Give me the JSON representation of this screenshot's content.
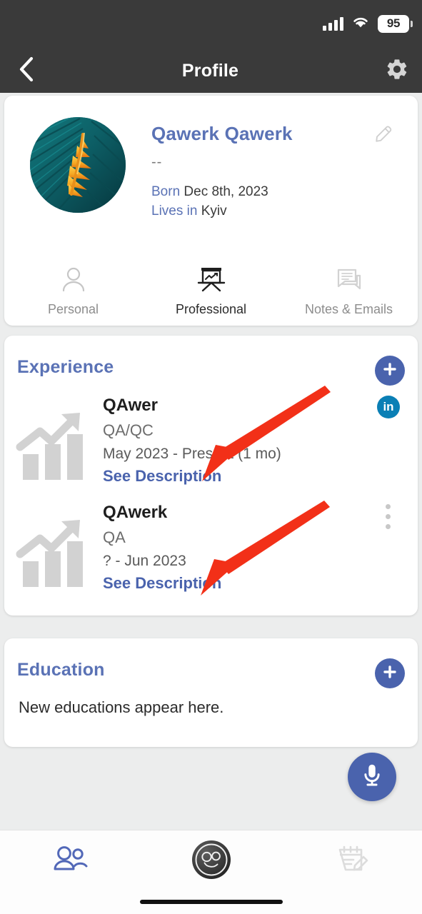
{
  "status_bar": {
    "signal_icon": "cellular-signal-icon",
    "wifi_icon": "wifi-icon",
    "battery_level": "95"
  },
  "header": {
    "back_icon": "chevron-left-icon",
    "title": "Profile",
    "settings_icon": "gear-icon",
    "background_color": "#3a3a3a"
  },
  "profile": {
    "avatar_icon": "avatar-photo",
    "name": "Qawerk Qawerk",
    "edit_icon": "pencil-icon",
    "subtitle": "--",
    "born_label": "Born",
    "born_value": "Dec 8th, 2023",
    "lives_label": "Lives in",
    "lives_value": "Kyiv",
    "name_color": "#5a72b5"
  },
  "tabs": [
    {
      "label": "Personal",
      "icon": "person-icon",
      "active": false
    },
    {
      "label": "Professional",
      "icon": "presentation-board-icon",
      "active": true
    },
    {
      "label": "Notes & Emails",
      "icon": "chat-bubbles-icon",
      "active": false
    }
  ],
  "experience": {
    "title": "Experience",
    "add_icon": "plus-icon",
    "add_color": "#4a63ad",
    "items": [
      {
        "icon": "growth-bar-chart-icon",
        "company": "QAwer",
        "role": "QA/QC",
        "dates": "May 2023 - Present (1 mo)",
        "description_link": "See Description",
        "badge": "linkedin-icon",
        "badge_label": "in",
        "badge_color": "#0a7fb5"
      },
      {
        "icon": "growth-bar-chart-icon",
        "company": "QAwerk",
        "role": "QA",
        "dates": "? - Jun 2023",
        "description_link": "See Description",
        "badge": "more-vertical-icon"
      }
    ]
  },
  "education": {
    "title": "Education",
    "add_icon": "plus-icon",
    "empty_text": "New educations appear here."
  },
  "mic_fab": {
    "icon": "microphone-icon",
    "color": "#4a63ad"
  },
  "bottom_nav": [
    {
      "icon": "contacts-people-icon",
      "active": true
    },
    {
      "icon": "app-logo-icon",
      "active": false
    },
    {
      "icon": "calendar-edit-icon",
      "active": false
    }
  ],
  "annotations": {
    "arrow_color": "#f23018",
    "arrow_count": 2
  }
}
